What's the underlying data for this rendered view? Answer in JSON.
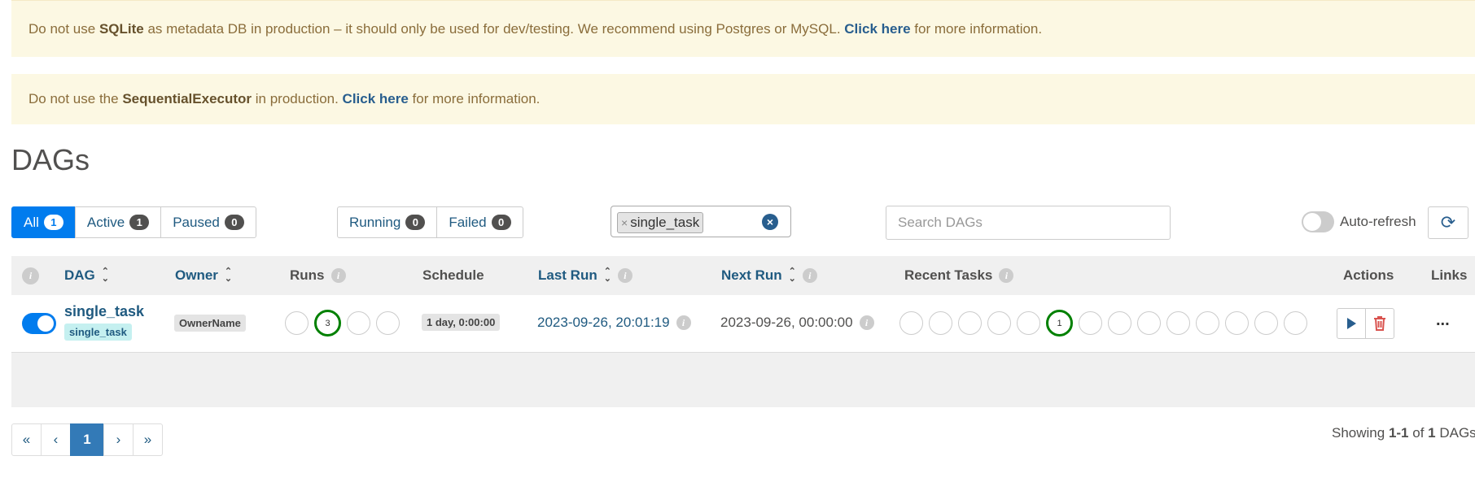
{
  "alerts": {
    "sqlite": {
      "pre": "Do not use ",
      "bold": "SQLite",
      "mid": " as metadata DB in production – it should only be used for dev/testing. We recommend using Postgres or MySQL. ",
      "link": "Click here",
      "post": " for more information."
    },
    "executor": {
      "pre": "Do not use the ",
      "bold": "SequentialExecutor",
      "mid": " in production. ",
      "link": "Click here",
      "post": " for more information."
    }
  },
  "page_title": "DAGs",
  "status_filter": [
    {
      "label": "All",
      "count": "1"
    },
    {
      "label": "Active",
      "count": "1"
    },
    {
      "label": "Paused",
      "count": "0"
    }
  ],
  "run_filter": [
    {
      "label": "Running",
      "count": "0"
    },
    {
      "label": "Failed",
      "count": "0"
    }
  ],
  "tag_filter": {
    "remove": "×",
    "tag": "single_task",
    "clear": "×"
  },
  "search": {
    "placeholder": "Search DAGs"
  },
  "auto_refresh_label": "Auto-refresh",
  "table": {
    "headers": {
      "dag": "DAG",
      "owner": "Owner",
      "runs": "Runs",
      "schedule": "Schedule",
      "last_run": "Last Run",
      "next_run": "Next Run",
      "recent_tasks": "Recent Tasks",
      "actions": "Actions",
      "links": "Links"
    },
    "row": {
      "dag_id": "single_task",
      "tag": "single_task",
      "owner": "OwnerName",
      "runs_success_count": "3",
      "schedule": "1 day, 0:00:00",
      "last_run": "2023-09-26, 20:01:19",
      "next_run": "2023-09-26, 00:00:00",
      "recent_tasks_success_count": "1",
      "links_more": "..."
    }
  },
  "pagination": {
    "first": "«",
    "prev": "‹",
    "current": "1",
    "next": "›",
    "last": "»"
  },
  "showing": {
    "pre": "Showing ",
    "range": "1-1",
    "mid": " of ",
    "total": "1",
    "post": " DAGs"
  },
  "colors": {
    "primary": "#017cee",
    "success": "#008000",
    "alert_bg": "#fcf8e3",
    "link": "#1f5a80",
    "danger": "#d9534f"
  }
}
